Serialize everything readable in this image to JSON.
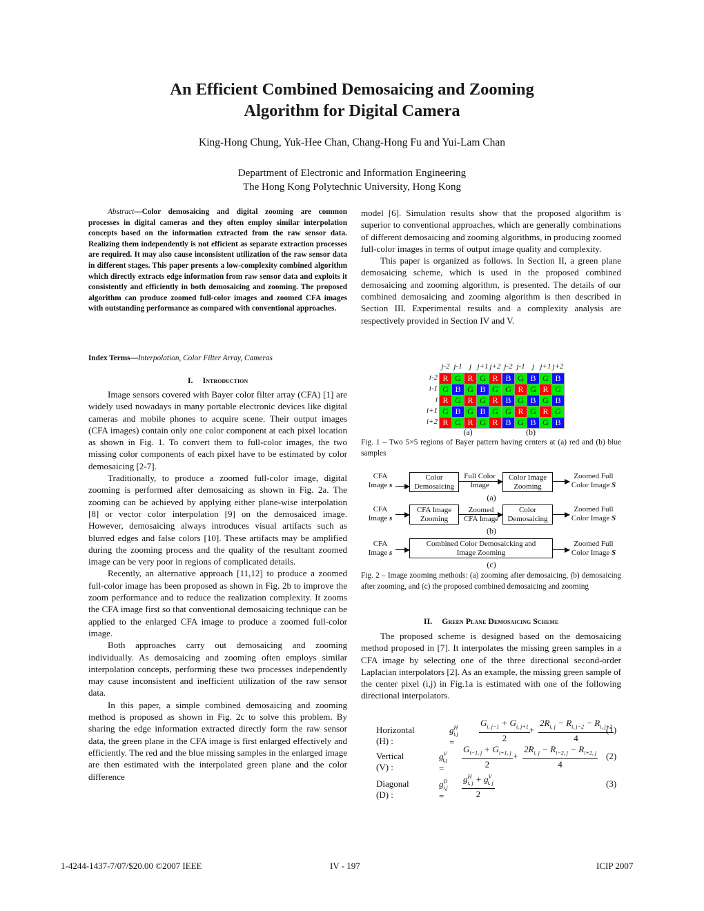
{
  "title_lines": [
    "An Efficient Combined Demosaicing and Zooming",
    "Algorithm for Digital Camera"
  ],
  "authors": "King-Hong Chung, Yuk-Hee Chan, Chang-Hong Fu and Yui-Lam Chan",
  "affiliation": [
    "Department of Electronic and Information Engineering",
    "The Hong Kong Polytechnic University, Hong Kong"
  ],
  "abstract": {
    "lead": "Abstract",
    "dash": "—",
    "text": "Color demosaicing and digital zooming are common processes in digital cameras and they often employ similar interpolation concepts based on the information extracted from the raw sensor data. Realizing them independently is not efficient as separate extraction processes are required. It may also cause inconsistent utilization of the raw sensor data in different stages. This paper presents a low-complexity combined algorithm which directly extracts edge information from raw sensor data and exploits it consistently and efficiently in both demosaicing and zooming. The proposed algorithm can produce zoomed full-color images and zoomed CFA images with outstanding performance as compared with conventional approaches."
  },
  "index_terms": {
    "label": "Index Terms—",
    "value": "Interpolation, Color Filter Array, Cameras"
  },
  "sections": {
    "intro": {
      "number": "I.",
      "title": "Introduction",
      "paragraphs": [
        "Image sensors covered with Bayer color filter array (CFA) [1] are widely used nowadays in many portable electronic devices like digital cameras and mobile phones to acquire scene. Their output images (CFA images) contain only one color component at each pixel location as shown in Fig. 1. To convert them to full-color images, the two missing color components of each pixel have to be estimated by color demosaicing [2-7].",
        "Traditionally, to produce a zoomed full-color image, digital zooming is performed after demosaicing as shown in Fig. 2a. The zooming can be achieved by applying either plane-wise interpolation [8] or vector color interpolation [9] on the demosaiced image. However, demosaicing always introduces visual artifacts such as blurred edges and false colors [10]. These artifacts may be amplified during the zooming process and the quality of the resultant zoomed image can be very poor in regions of complicated details.",
        "Recently, an alternative approach [11,12] to produce a zoomed full-color image has been proposed as shown in Fig. 2b to improve the zoom performance and to reduce the realization complexity. It zooms the CFA image first so that conventional demosaicing technique can be applied to the enlarged CFA image to produce a zoomed full-color image.",
        "Both approaches carry out demosaicing and zooming individually. As demosaicing and zooming often employs similar interpolation concepts, performing these two processes independently may cause inconsistent and inefficient utilization of the raw sensor data.",
        "In this paper, a simple combined demosaicing and zooming method is proposed as shown in Fig. 2c to solve this problem. By sharing the edge information extracted directly form the raw sensor data, the green plane in the CFA image is first enlarged effectively and efficiently. The red and the blue missing samples in the enlarged image are then estimated with the interpolated green plane and the color difference"
      ]
    },
    "right_continuation": [
      "model [6]. Simulation results show that the proposed algorithm is superior to conventional approaches, which are generally combinations of different demosaicing and zooming algorithms, in producing zoomed full-color images in terms of output image quality and complexity.",
      "This paper is organized as follows. In Section II, a green plane demosaicing scheme, which is used in the proposed combined demosaicing and zooming algorithm, is presented. The details of our combined demosaicing and zooming algorithm is then described in Section III. Experimental results and a complexity analysis are respectively provided in Section IV and V."
    ],
    "sec2": {
      "number": "II.",
      "title": "Green Plane Demosaicing Scheme",
      "paragraph": "The proposed scheme is designed based on the demosaicing method proposed in [7]. It interpolates the missing green samples in a CFA image by selecting one of the three directional second-order Laplacian interpolators [2]. As an example, the missing green sample of the center pixel (i,j) in Fig.1a is estimated with one of the following directional interpolators."
    }
  },
  "figure1": {
    "col_labels": [
      "j-2",
      "j-1",
      "j",
      "j+1",
      "j+2"
    ],
    "row_labels": [
      "i-2",
      "i-1",
      "i",
      "i+1",
      "i+2"
    ],
    "grid_a": [
      [
        "R",
        "G",
        "R",
        "G",
        "R"
      ],
      [
        "G",
        "B",
        "G",
        "B",
        "G"
      ],
      [
        "R",
        "G",
        "R",
        "G",
        "R"
      ],
      [
        "G",
        "B",
        "G",
        "B",
        "G"
      ],
      [
        "R",
        "G",
        "R",
        "G",
        "R"
      ]
    ],
    "grid_b": [
      [
        "B",
        "G",
        "B",
        "G",
        "B"
      ],
      [
        "G",
        "R",
        "G",
        "R",
        "G"
      ],
      [
        "B",
        "G",
        "B",
        "G",
        "B"
      ],
      [
        "G",
        "R",
        "G",
        "R",
        "G"
      ],
      [
        "B",
        "G",
        "B",
        "G",
        "B"
      ]
    ],
    "sub_a": "(a)",
    "sub_b": "(b)",
    "caption": "Fig. 1 – Two 5×5 regions of Bayer pattern having centers at (a) red and (b) blue samples",
    "colors": {
      "R": "#ff0000",
      "G": "#00ee00",
      "B": "#1010ff"
    }
  },
  "figure2": {
    "input": {
      "line1": "CFA",
      "line2": "Image ",
      "var": "s"
    },
    "output": {
      "line1": "Zoomed Full",
      "line2": "Color Image ",
      "var": "S"
    },
    "a": {
      "box1": [
        "Color",
        "Demosaicing"
      ],
      "mid": [
        "Full Color",
        "Image"
      ],
      "box2": [
        "Color Image",
        "Zooming"
      ],
      "label": "(a)"
    },
    "b": {
      "box1": [
        "CFA Image",
        "Zooming"
      ],
      "mid": [
        "Zoomed",
        "CFA Image"
      ],
      "box2": [
        "Color",
        "Demosaicing"
      ],
      "label": "(b)"
    },
    "c": {
      "box": [
        "Combined Color Demosaicking and",
        "Image Zooming"
      ],
      "label": "(c)"
    },
    "caption": "Fig. 2 – Image zooming methods: (a) zooming after demosaicing, (b) demosaicing after zooming, and (c) the proposed combined demosaicing and zooming"
  },
  "equations": [
    {
      "label": "Horizontal (H) :",
      "lhs_sup": "H",
      "num1": "G_{i,j−1} + G_{i,j+1}",
      "den1": "2",
      "num2": "2R_{i,j} − R_{i,j−2} − R_{i,j+2}",
      "den2": "4",
      "number": "(1)"
    },
    {
      "label": "Vertical (V) :",
      "lhs_sup": "V",
      "num1": "G_{i−1,j} + G_{i+1,j}",
      "den1": "2",
      "num2": "2R_{i,j} − R_{i−2,j} − R_{i+2,j}",
      "den2": "4",
      "number": "(2)"
    },
    {
      "label": "Diagonal (D) :",
      "lhs_sup": "D",
      "num1": "g^H_{i,j} + g^V_{i,j}",
      "den1": "2",
      "number": "(3)"
    }
  ],
  "footer": {
    "left": "1-4244-1437-7/07/$20.00 ©2007 IEEE",
    "center": "IV - 197",
    "right": "ICIP 2007"
  }
}
